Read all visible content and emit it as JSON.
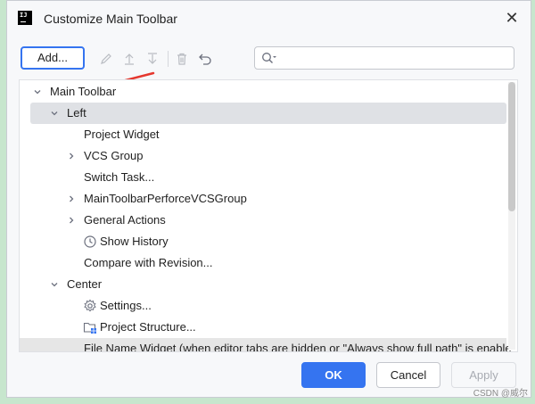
{
  "dialog": {
    "title": "Customize Main Toolbar",
    "app_icon_text": "IJ"
  },
  "toolbar": {
    "add_label": "Add...",
    "search_placeholder": ""
  },
  "tree": {
    "items": [
      {
        "label": "Main Toolbar",
        "expanded": true
      },
      {
        "label": "Left",
        "expanded": true,
        "selected": true
      },
      {
        "label": "Project Widget"
      },
      {
        "label": "VCS Group",
        "expanded": false
      },
      {
        "label": "Switch Task..."
      },
      {
        "label": "MainToolbarPerforceVCSGroup",
        "expanded": false
      },
      {
        "label": "General Actions",
        "expanded": false
      },
      {
        "label": "Show History",
        "icon": "clock-icon"
      },
      {
        "label": "Compare with Revision..."
      },
      {
        "label": "Center",
        "expanded": true
      },
      {
        "label": "Settings...",
        "icon": "gear-icon"
      },
      {
        "label": "Project Structure...",
        "icon": "folder-grid-icon"
      },
      {
        "label": "File Name Widget (when editor tabs are hidden or \"Always show full path\" is enable"
      }
    ]
  },
  "buttons": {
    "ok": "OK",
    "cancel": "Cancel",
    "apply": "Apply"
  },
  "watermark": "CSDN @威尔"
}
